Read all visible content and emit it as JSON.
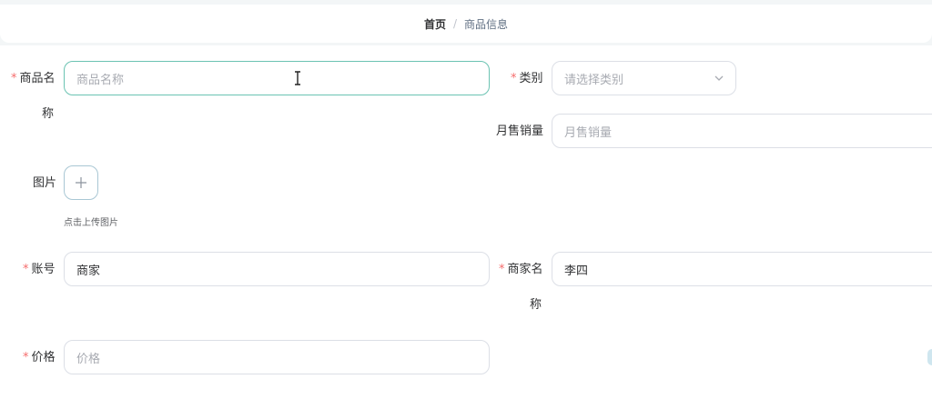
{
  "breadcrumb": {
    "home": "首页",
    "separator": "/",
    "current": "商品信息"
  },
  "form": {
    "name": {
      "label_line1": "商品名",
      "label_line2": "称",
      "placeholder": "商品名称",
      "value": "",
      "required": true
    },
    "category": {
      "label": "类别",
      "placeholder": "请选择类别",
      "required": true,
      "arrow_icon": "chevron-down-icon"
    },
    "monthly_sales": {
      "label": "月售销量",
      "placeholder": "月售销量",
      "value": ""
    },
    "image": {
      "label": "图片",
      "upload_icon": "plus-icon",
      "upload_tip": "点击上传图片"
    },
    "account": {
      "label": "账号",
      "value": "商家",
      "required": true
    },
    "merchant_name": {
      "label_line1": "商家名",
      "label_line2": "称",
      "value": "李四",
      "required": true
    },
    "price": {
      "label": "价格",
      "placeholder": "价格",
      "value": "",
      "required": true
    }
  },
  "colors": {
    "required_star": "#f56c6c",
    "focus_border": "#6bc3b2",
    "input_border": "#dcdfe6",
    "placeholder": "#a8abb2",
    "background_band": "#f3f6f7"
  }
}
